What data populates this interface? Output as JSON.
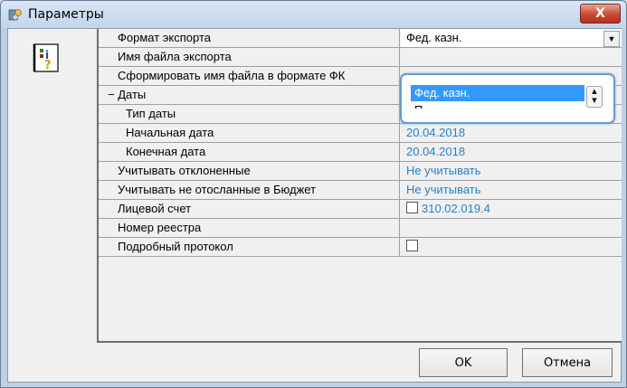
{
  "window": {
    "title": "Параметры",
    "close_label": "X"
  },
  "grid": {
    "rows": [
      {
        "name": "Формат экспорта",
        "value": "Фед. казн."
      },
      {
        "name": "Имя файла экспорта",
        "value": ""
      },
      {
        "name": "Сформировать имя файла в формате ФК",
        "value": ""
      },
      {
        "name": "− Даты",
        "value": ""
      },
      {
        "name": "Тип даты",
        "value": ""
      },
      {
        "name": "Начальная дата",
        "value": "20.04.2018"
      },
      {
        "name": "Конечная дата",
        "value": "20.04.2018"
      },
      {
        "name": "Учитывать отклоненные",
        "value": "Не учитывать"
      },
      {
        "name": "Учитывать не отосланные в Бюджет",
        "value": "Не учитывать"
      },
      {
        "name": "Лицевой счет",
        "value": "310.02.019.4"
      },
      {
        "name": "Номер реестра",
        "value": ""
      },
      {
        "name": "Подробный протокол",
        "value": ""
      }
    ]
  },
  "dropdown": {
    "selected_option": "Фед. казн.",
    "next_option_partial": "П"
  },
  "buttons": {
    "ok": "OK",
    "cancel": "Отмена"
  },
  "colors": {
    "value_blue": "#2a7fc8",
    "selection": "#3399ff",
    "close_red": "#c74a32"
  },
  "icons": {
    "app": "parameters-app-icon",
    "help": "help-book-icon",
    "close": "close-icon"
  }
}
